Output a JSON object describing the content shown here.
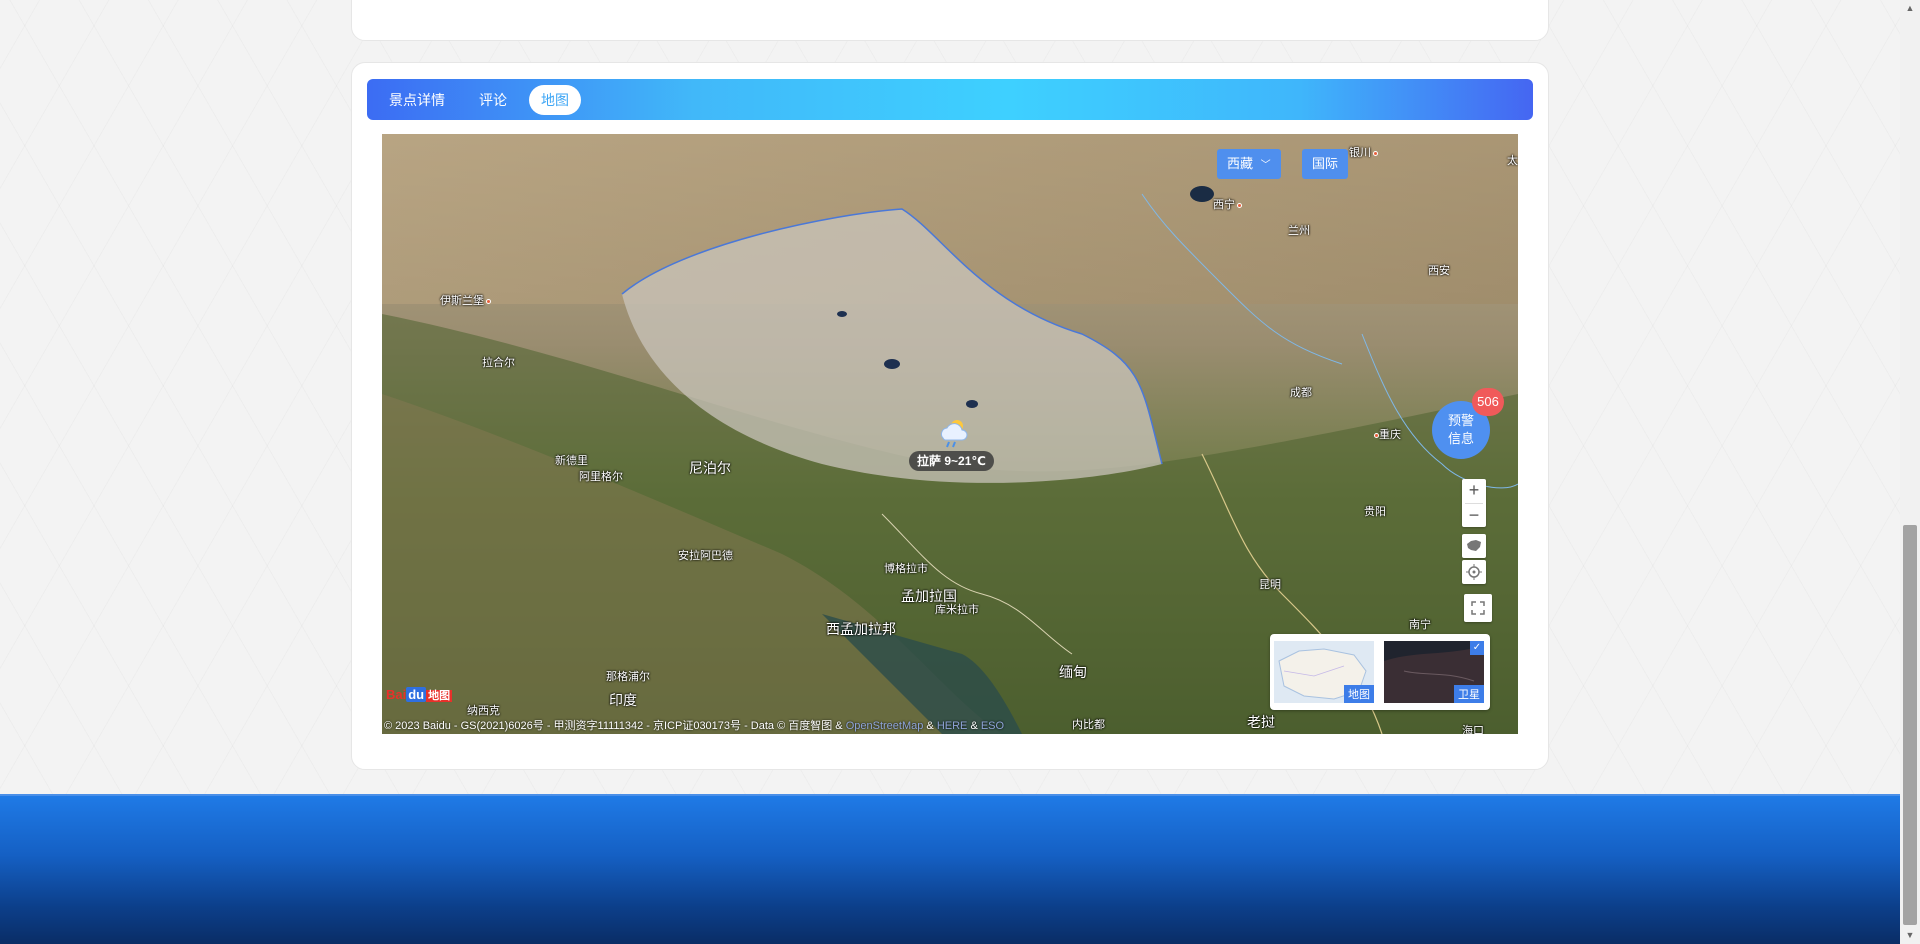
{
  "tabs": [
    {
      "label": "景点详情",
      "active": false
    },
    {
      "label": "评论",
      "active": false
    },
    {
      "label": "地图",
      "active": true
    }
  ],
  "map": {
    "region_select": "西藏",
    "international": "国际",
    "weather": {
      "city": "拉萨",
      "temp": "9~21℃",
      "label": "拉萨 9~21℃",
      "icon": "cloud-rain-sun-icon"
    },
    "warning": {
      "line1": "预警",
      "line2": "信息",
      "count": "506"
    },
    "labels": [
      {
        "text": "银川",
        "dot": true
      },
      {
        "text": "太",
        "dot": false
      },
      {
        "text": "西宁",
        "dot": true
      },
      {
        "text": "兰州",
        "dot": true
      },
      {
        "text": "西安",
        "dot": true
      },
      {
        "text": "伊斯兰堡",
        "dot": true
      },
      {
        "text": "拉合尔",
        "dot": false
      },
      {
        "text": "成都",
        "dot": true
      },
      {
        "text": "重庆",
        "dot": true
      },
      {
        "text": "新德里",
        "dot": false
      },
      {
        "text": "阿里格尔",
        "dot": false
      },
      {
        "text": "尼泊尔",
        "dot": false
      },
      {
        "text": "贵阳",
        "dot": true
      },
      {
        "text": "安拉阿巴德",
        "dot": false
      },
      {
        "text": "博格拉市",
        "dot": false
      },
      {
        "text": "孟加拉国",
        "dot": false
      },
      {
        "text": "库米拉市",
        "dot": false
      },
      {
        "text": "昆明",
        "dot": true
      },
      {
        "text": "西孟加拉邦",
        "dot": false
      },
      {
        "text": "南宁",
        "dot": false
      },
      {
        "text": "缅甸",
        "dot": false
      },
      {
        "text": "那格浦尔",
        "dot": false
      },
      {
        "text": "印度",
        "dot": false
      },
      {
        "text": "纳西克",
        "dot": false
      },
      {
        "text": "老挝",
        "dot": false
      },
      {
        "text": "海口",
        "dot": false
      },
      {
        "text": "内比都",
        "dot": false
      }
    ],
    "maptype": {
      "map": "地图",
      "satellite": "卫星",
      "check": "✓"
    },
    "logo": {
      "bai": "Bai",
      "du": "du",
      "ditu": "地图"
    },
    "copyright": {
      "main": "© 2023 Baidu - GS(2021)6026号 - 甲测资字11111342 - 京ICP证030173号 - Data © 百度智图 & ",
      "osm": "OpenStreetMap",
      "amp1": " & ",
      "here": "HERE",
      "amp2": " & ",
      "eso": "ESO"
    },
    "controls": {
      "zoom_in": "+",
      "zoom_out": "−"
    }
  },
  "colors": {
    "accent": "#3ea6f5",
    "footer": "#1560c4",
    "warning_badge": "#f05a5a"
  }
}
